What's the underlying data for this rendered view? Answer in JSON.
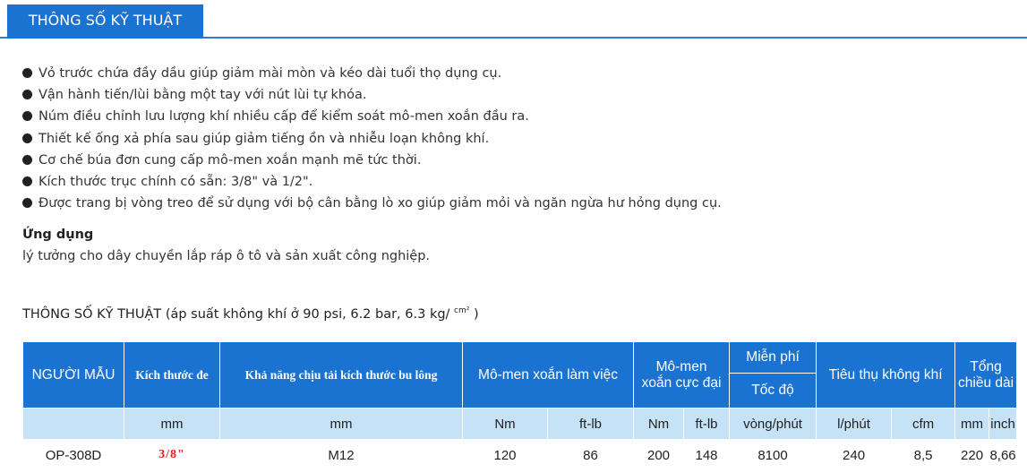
{
  "tab": {
    "label": "THÔNG SỐ KỸ THUẬT"
  },
  "features": [
    "Vỏ trước chứa đầy dầu giúp giảm mài mòn và kéo dài tuổi thọ dụng cụ.",
    "Vận hành tiến/lùi bằng một tay với nút lùi tự khóa.",
    "Núm điều chỉnh lưu lượng khí nhiều cấp để kiểm soát mô-men xoắn đầu ra.",
    "Thiết kế ống xả phía sau giúp giảm tiếng ồn và nhiễu loạn không khí.",
    "Cơ chế búa đơn cung cấp mô-men xoắn mạnh mẽ tức thời.",
    "Kích thước trục chính có sẵn: 3/8\" và 1/2\".",
    "Được trang bị vòng treo để sử dụng với bộ cân bằng lò xo giúp giảm mỏi và ngăn ngừa hư hỏng dụng cụ."
  ],
  "application": {
    "title": "Ứng dụng",
    "text": "lý tưởng cho dây chuyền lắp ráp ô tô và sản xuất công nghiệp."
  },
  "spec": {
    "title": "THÔNG SỐ KỸ THUẬT (áp suất không khí ở 90 psi, 6.2 bar, 6.3 kg/",
    "unit_sup": "cm²",
    "title_end": ")"
  },
  "table": {
    "headers": {
      "model": "NGƯỜI MẪU",
      "drive": "Kích thước đe",
      "bolt": "Khả năng chịu tải kích thước bu lông",
      "work_torque": "Mô-men xoắn làm việc",
      "max_torque_1": "Mô-men",
      "max_torque_2": "xoắn cực đại",
      "free": "Miễn phí",
      "speed": "Tốc độ",
      "air": "Tiêu thụ không khí",
      "length_1": "Tổng",
      "length_2": "chiều dài"
    },
    "units": {
      "drive": "mm",
      "bolt": "mm",
      "work_nm": "Nm",
      "work_ftlb": "ft-lb",
      "max_nm": "Nm",
      "max_ftlb": "ft-lb",
      "speed": "vòng/phút",
      "air_lpm": "l/phút",
      "air_cfm": "cfm",
      "len_mm": "mm",
      "len_in": "inch"
    },
    "row": {
      "model": "OP-308D",
      "drive": "3/8\"",
      "bolt": "M12",
      "work_nm": "120",
      "work_ftlb": "86",
      "max_nm": "200",
      "max_ftlb": "148",
      "speed": "8100",
      "air_lpm": "240",
      "air_cfm": "8,5",
      "len_mm": "220",
      "len_in": "8,66"
    }
  },
  "colors": {
    "accent": "#1a72d1",
    "unit_row": "#c5e2f7",
    "highlight": "#e0221b"
  }
}
